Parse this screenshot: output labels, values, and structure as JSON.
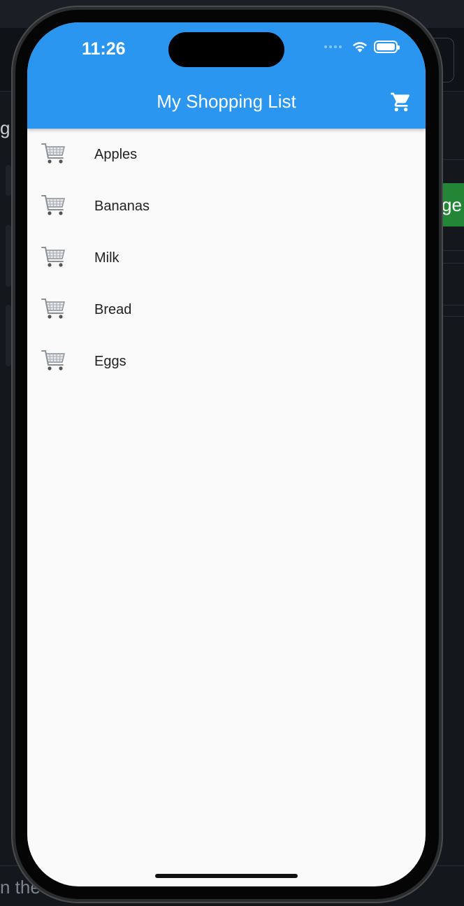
{
  "status_bar": {
    "time": "11:26"
  },
  "app_bar": {
    "title": "My Shopping List",
    "action_icon": "shopping-cart-icon"
  },
  "items": [
    {
      "label": "Apples",
      "icon": "cart-emoji-icon"
    },
    {
      "label": "Bananas",
      "icon": "cart-emoji-icon"
    },
    {
      "label": "Milk",
      "icon": "cart-emoji-icon"
    },
    {
      "label": "Bread",
      "icon": "cart-emoji-icon"
    },
    {
      "label": "Eggs",
      "icon": "cart-emoji-icon"
    }
  ],
  "background_window": {
    "left_fragment": "g",
    "button_fragment": "ge",
    "bottom_fragment": "n the ,"
  },
  "colors": {
    "app_bar": "#2a96f0",
    "background": "#fafafa",
    "text": "#222222"
  }
}
